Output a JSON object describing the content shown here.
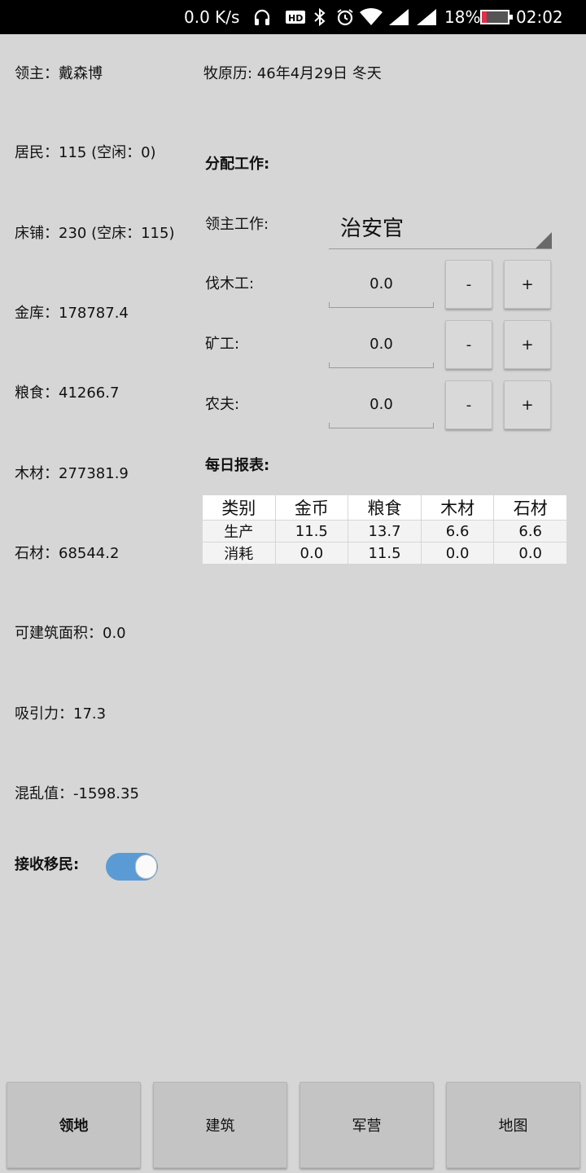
{
  "statusbar": {
    "speed": "0.0 K/s",
    "battery_pct": "18%",
    "time": "02:02",
    "icons": [
      "headphones-icon",
      "hd-icon",
      "bluetooth-icon",
      "alarm-icon",
      "wifi-icon",
      "signal-icon",
      "signal-icon"
    ],
    "battery_level": 0.18
  },
  "left": {
    "lord": "领主：戴森博",
    "residents": "居民：115 (空闲：0)",
    "beds": "床铺：230 (空床：115)",
    "treasury": "金库：178787.4",
    "grain": "粮食：41266.7",
    "wood": "木材：277381.9",
    "stone": "石材：68544.2",
    "build_area": "可建筑面积：0.0",
    "attraction": "吸引力：17.3",
    "chaos": "混乱值：-1598.35",
    "accept_label": "接收移民:",
    "accept_on": true
  },
  "right": {
    "calendar": "牧原历: 46年4月29日  冬天",
    "assign_title": "分配工作:",
    "lord_job_label": "领主工作:",
    "lord_job_value": "治安官",
    "jobs": [
      {
        "label": "伐木工:",
        "value": "0.0"
      },
      {
        "label": "矿工:",
        "value": "0.0"
      },
      {
        "label": "农夫:",
        "value": "0.0"
      }
    ],
    "minus": "-",
    "plus": "+",
    "report_title": "每日报表:",
    "report": {
      "header": [
        "类别",
        "金币",
        "粮食",
        "木材",
        "石材"
      ],
      "rows": [
        [
          "生产",
          "11.5",
          "13.7",
          "6.6",
          "6.6"
        ],
        [
          "消耗",
          "0.0",
          "11.5",
          "0.0",
          "0.0"
        ]
      ]
    }
  },
  "nav": [
    "领地",
    "建筑",
    "军营",
    "地图"
  ]
}
